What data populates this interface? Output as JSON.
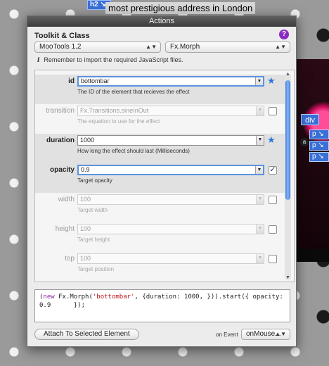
{
  "background": {
    "h2_tag": "h2",
    "headline": "most prestigious address in London",
    "div_tag": "div",
    "p_tags": [
      "p",
      "p",
      "p"
    ],
    "circle_marker": "a"
  },
  "dialog": {
    "title": "Actions",
    "section_title": "Toolkit & Class",
    "help_icon": "?",
    "toolkit": {
      "value": "MooTools 1.2"
    },
    "class": {
      "value": "Fx.Morph"
    },
    "note_icon": "i",
    "note": "Remember to import the required JavaScript files.",
    "params": [
      {
        "label": "id",
        "value": "bottombar",
        "desc": "The ID of the element that recieves the effect",
        "state": "selected",
        "marker": "star"
      },
      {
        "label": "transition",
        "value": "Fx.Transitions.sineInOut",
        "desc": "The equation to use for the effect",
        "state": "disabled",
        "marker": "checkbox"
      },
      {
        "label": "duration",
        "value": "1000",
        "desc": "How long the effect should last (Milliseconds)",
        "state": "enabled",
        "marker": "star"
      },
      {
        "label": "opacity",
        "value": "0.9",
        "desc": "Target opacity",
        "state": "selected",
        "marker": "checkbox-checked"
      },
      {
        "label": "width",
        "value": "100",
        "desc": "Target width",
        "state": "disabled",
        "marker": "checkbox"
      },
      {
        "label": "height",
        "value": "100",
        "desc": "Target height",
        "state": "disabled",
        "marker": "checkbox"
      },
      {
        "label": "top",
        "value": "100",
        "desc": "Target position",
        "state": "disabled",
        "marker": "checkbox"
      }
    ],
    "code": {
      "p1": "(",
      "kw": "new",
      "p2": " Fx.Morph(",
      "str": "'bottombar'",
      "p3": ", {duration: 1000, })).start({ opacity:\n0.9      });"
    },
    "attach_button": "Attach To Selected Element",
    "event_label": "on Event",
    "event_select": {
      "value": "onMouse..."
    }
  },
  "colors": {
    "accent": "#2a78d8",
    "tag_blue": "#3a6fd6"
  }
}
